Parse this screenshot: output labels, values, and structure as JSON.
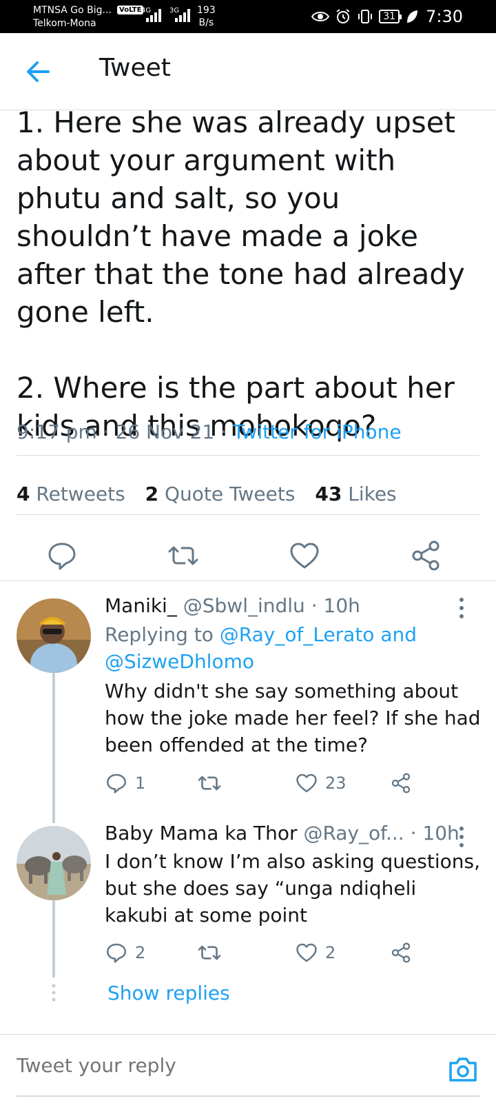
{
  "status_bar": {
    "carrier1": "MTNSA Go Big...",
    "carrier2": "Telkom-Mona",
    "volte": "VoLTE",
    "net1": "4G",
    "net2": "3G",
    "speed_value": "193",
    "speed_unit": "B/s",
    "battery": "31",
    "time": "7:30"
  },
  "header": {
    "title": "Tweet"
  },
  "main_tweet": {
    "text": "1. Here she was already upset about your argument with phutu and salt, so you shouldn’t have made a joke after that the tone had already gone left.\n\n2. Where is the part about her kids and this mohokoqo?",
    "time": "9:17 pm",
    "date": "26 Nov 21",
    "source": "Twitter for iPhone",
    "separator": " · ",
    "retweets_count": "4",
    "retweets_label": "Retweets",
    "quotes_count": "2",
    "quotes_label": "Quote Tweets",
    "likes_count": "43",
    "likes_label": "Likes"
  },
  "replies": [
    {
      "name": "Maniki_",
      "handle": "@Sbwl_indlu",
      "time": "10h",
      "replying_prefix": "Replying to",
      "replying_handle1": "@Ray_of_Lerato",
      "replying_and": "and",
      "replying_handle2": "@SizweDhlomo",
      "text": "Why didn't she say something about how the joke made her feel? If she had been offended at the time?",
      "reply_count": "1",
      "retweet_count": "",
      "like_count": "23"
    },
    {
      "name": "Baby Mama ka Thor",
      "handle": "@Ray_of...",
      "time": "10h",
      "text": "I don’t know I’m also asking questions, but she does say “unga ndiqheli kakubi at some point",
      "reply_count": "2",
      "retweet_count": "",
      "like_count": "2"
    }
  ],
  "show_replies": "Show replies",
  "composer": {
    "placeholder": "Tweet your reply"
  },
  "icons": {
    "back": "arrow-left-icon",
    "reply": "speech-bubble-icon",
    "retweet": "retweet-icon",
    "like": "heart-icon",
    "share": "share-icon",
    "camera": "camera-icon",
    "more": "more-vertical-icon"
  },
  "colors": {
    "accent": "#1da1f2",
    "text": "#14171a",
    "secondary": "#657786",
    "divider": "#d6dbe0"
  }
}
